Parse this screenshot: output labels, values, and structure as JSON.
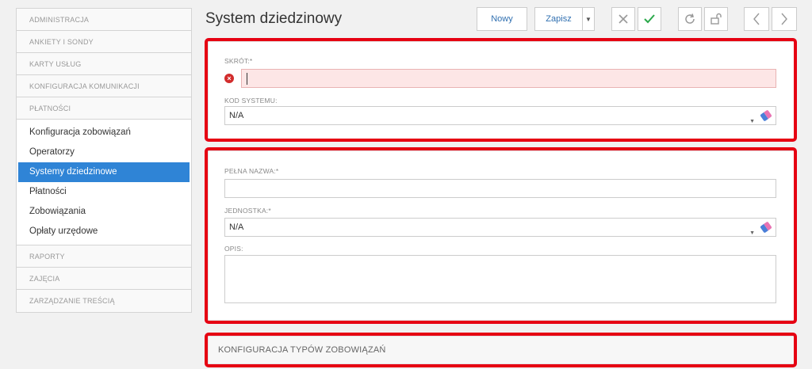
{
  "sidebar": {
    "sections_top": [
      "ADMINISTRACJA",
      "ANKIETY I SONDY",
      "KARTY USŁUG",
      "KONFIGURACJA KOMUNIKACJI",
      "PŁATNOŚCI"
    ],
    "items": [
      "Konfiguracja zobowiązań",
      "Operatorzy",
      "Systemy dziedzinowe",
      "Płatności",
      "Zobowiązania",
      "Opłaty urzędowe"
    ],
    "active_index": 2,
    "sections_bottom": [
      "RAPORTY",
      "ZAJĘCIA",
      "ZARZĄDZANIE TREŚCIĄ"
    ]
  },
  "header": {
    "title": "System dziedzinowy"
  },
  "toolbar": {
    "new_label": "Nowy",
    "save_label": "Zapisz",
    "cancel_icon": "close-icon",
    "confirm_icon": "check-icon",
    "refresh_icon": "refresh-icon",
    "unlock_icon": "unlock-icon",
    "prev_icon": "chevron-left-icon",
    "next_icon": "chevron-right-icon"
  },
  "form1": {
    "skrot_label": "SKRÓT:*",
    "skrot_value": "",
    "kod_label": "KOD SYSTEMU:",
    "kod_value": "N/A"
  },
  "form2": {
    "pelna_label": "PEŁNA NAZWA:*",
    "pelna_value": "",
    "jednostka_label": "JEDNOSTKA:*",
    "jednostka_value": "N/A",
    "opis_label": "OPIS:"
  },
  "section3": {
    "title": "KONFIGURACJA TYPÓW ZOBOWIĄZAŃ"
  },
  "colors": {
    "accent": "#2f84d6",
    "highlight": "#e60012",
    "error": "#d22c2c",
    "confirm": "#2aa84a"
  }
}
